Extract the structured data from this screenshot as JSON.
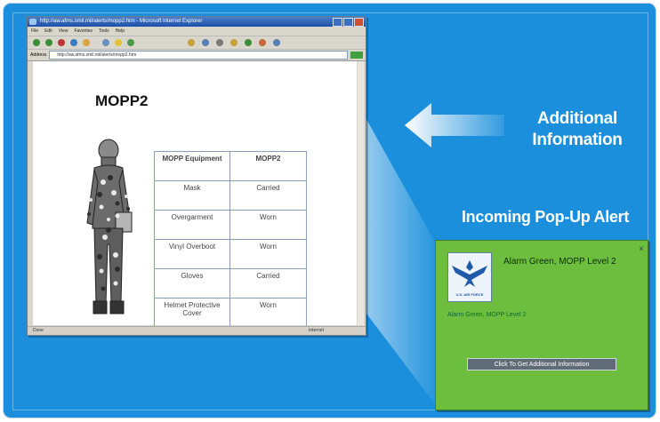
{
  "browser": {
    "title": "http://aw.afms.smil.mil/alerts/mopp2.htm - Microsoft Internet Explorer",
    "menu": [
      "File",
      "Edit",
      "View",
      "Favorites",
      "Tools",
      "Help"
    ],
    "address_label": "Address",
    "address": "http://aw.afms.smil.mil/alerts/mopp2.htm",
    "status_left": "Done",
    "status_right": "Internet"
  },
  "page": {
    "heading": "MOPP2",
    "table": {
      "headers": [
        "MOPP Equipment",
        "MOPP2"
      ],
      "rows": [
        [
          "Mask",
          "Carried"
        ],
        [
          "Overgarment",
          "Worn"
        ],
        [
          "Vinyl Overboot",
          "Worn"
        ],
        [
          "Gloves",
          "Carried"
        ],
        [
          "Helmet Protective Cover",
          "Worn"
        ]
      ]
    }
  },
  "callouts": {
    "additional_line1": "Additional",
    "additional_line2": "Information",
    "incoming": "Incoming Pop-Up Alert"
  },
  "popup": {
    "close": "x",
    "logo_text": "U.S. AIR FORCE",
    "title": "Alarm Green, MOPP Level 2",
    "body": "Alarm Green, MOPP Level 2",
    "button": "Click To Get Additional Information"
  },
  "colors": {
    "background": "#1b8fdc",
    "popup": "#6dbe3f"
  }
}
